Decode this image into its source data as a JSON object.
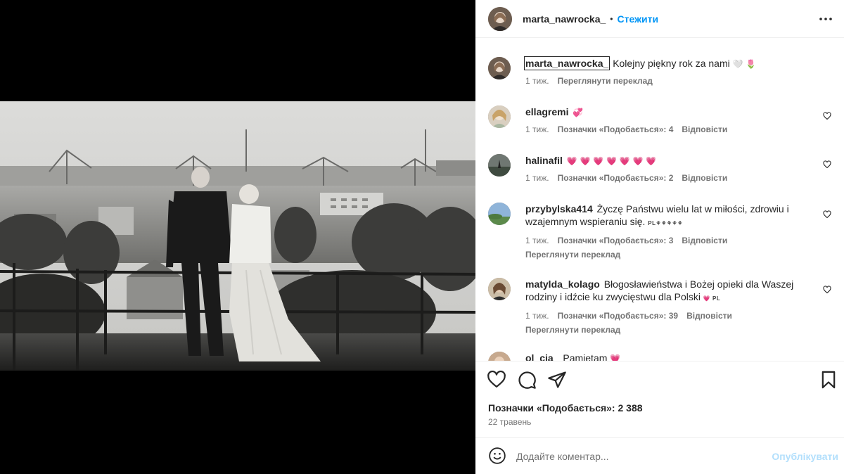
{
  "post": {
    "username": "marta_nawrocka_",
    "follow_label": "Стежити",
    "more_icon": "more-horizontal-icon"
  },
  "photo": {
    "description_style": "sepia/black-and-white"
  },
  "caption": {
    "username": "marta_nawrocka_",
    "text": "Kolejny piękny rok za nami",
    "emoji": "🤍 🌷",
    "time": "1 тиж.",
    "translate_label": "Переглянути переклад"
  },
  "comments": [
    {
      "username": "ellagremi",
      "text": "",
      "emoji": "💞",
      "time": "1 тиж.",
      "likes": "Позначки «Подобається»: 4",
      "reply": "Відповісти"
    },
    {
      "username": "halinafil",
      "text": "",
      "emoji": "💗 💗 💗 💗 💗 💗 💗",
      "time": "1 тиж.",
      "likes": "Позначки «Подобається»: 2",
      "reply": "Відповісти"
    },
    {
      "username": "przybylska414",
      "text": "Życzę Państwu wielu lat w miłości, zdrowiu i wzajemnym wspieraniu się.",
      "emoji": "PL⚘⚘⚘⚘⚘",
      "time": "1 тиж.",
      "likes": "Позначки «Подобається»: 3",
      "reply": "Відповісти",
      "translate_label": "Переглянути переклад"
    },
    {
      "username": "matylda_kolago",
      "text": "Błogosławieństwa i Bożej opieki dla Waszej rodziny i idźcie ku zwycięstwu dla Polski",
      "emoji": "💗 PL",
      "time": "1 тиж.",
      "likes": "Позначки «Подобається»: 39",
      "reply": "Відповісти",
      "translate_label": "Переглянути переклад"
    },
    {
      "username": "ol_cia_",
      "text": "Pamiętam",
      "emoji": "💗"
    }
  ],
  "footer": {
    "likes_text": "Позначки «Подобається»: 2 388",
    "date": "22 травень",
    "comment_placeholder": "Додайте коментар...",
    "publish_label": "Опублікувати"
  },
  "colors": {
    "link_blue": "#0095f6",
    "publish_disabled": "#b2dffc",
    "muted_text": "#737373",
    "heart_pink": "#ed4a74"
  }
}
